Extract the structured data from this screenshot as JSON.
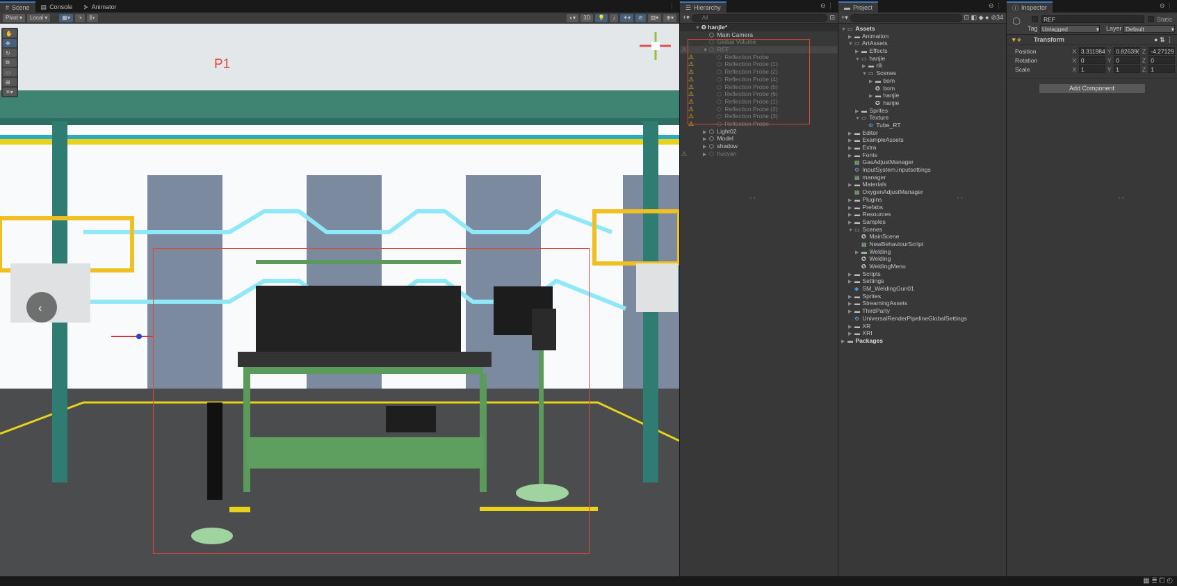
{
  "scene_panel": {
    "tabs": [
      "Scene",
      "Console",
      "Animator"
    ],
    "toolbar": {
      "pivot": "Pivot",
      "local": "Local",
      "mode_2d": "3D"
    },
    "annotation": "P1"
  },
  "hierarchy": {
    "title": "Hierarchy",
    "search_placeholder": "All",
    "scene_name": "hanjie*",
    "items": [
      {
        "label": "Main Camera",
        "depth": 1,
        "dim": false
      },
      {
        "label": "Global Volume",
        "depth": 1,
        "dim": true
      },
      {
        "label": "REF",
        "depth": 1,
        "dim": true,
        "expanded": true,
        "warn": true,
        "selected": true
      },
      {
        "label": "Reflection Probe",
        "depth": 2,
        "dim": true,
        "warn": true
      },
      {
        "label": "Reflection Probe (1)",
        "depth": 2,
        "dim": true,
        "warn": true
      },
      {
        "label": "Reflection Probe (2)",
        "depth": 2,
        "dim": true,
        "warn": true
      },
      {
        "label": "Reflection Probe (4)",
        "depth": 2,
        "dim": true,
        "warn": true
      },
      {
        "label": "Reflection Probe (5)",
        "depth": 2,
        "dim": true,
        "warn": true
      },
      {
        "label": "Reflection Probe (6)",
        "depth": 2,
        "dim": true,
        "warn": true
      },
      {
        "label": "Reflection Probe (1)",
        "depth": 2,
        "dim": true,
        "warn": true
      },
      {
        "label": "Reflection Probe (2)",
        "depth": 2,
        "dim": true,
        "warn": true
      },
      {
        "label": "Reflection Probe (3)",
        "depth": 2,
        "dim": true,
        "warn": true
      },
      {
        "label": "Reflection Probe",
        "depth": 2,
        "dim": true,
        "warn": true
      },
      {
        "label": "Light02",
        "depth": 1,
        "dim": false,
        "collapsed": true
      },
      {
        "label": "Model",
        "depth": 1,
        "dim": false,
        "collapsed": true
      },
      {
        "label": "shadow",
        "depth": 1,
        "dim": false,
        "collapsed": true
      },
      {
        "label": "huoyan",
        "depth": 1,
        "dim": true,
        "collapsed": true,
        "warn": true
      }
    ]
  },
  "project": {
    "title": "Project",
    "hidden_count": "34",
    "items": [
      {
        "label": "Assets",
        "d": 0,
        "t": "fo",
        "bold": true
      },
      {
        "label": "Animation",
        "d": 1,
        "t": "f"
      },
      {
        "label": "ArtAssets",
        "d": 1,
        "t": "fo"
      },
      {
        "label": "Effects",
        "d": 2,
        "t": "f"
      },
      {
        "label": "hanjie",
        "d": 2,
        "t": "fo"
      },
      {
        "label": "rili",
        "d": 3,
        "t": "f"
      },
      {
        "label": "Scenes",
        "d": 3,
        "t": "fo"
      },
      {
        "label": "bom",
        "d": 4,
        "t": "f"
      },
      {
        "label": "bom",
        "d": 4,
        "t": "s"
      },
      {
        "label": "hanjie",
        "d": 4,
        "t": "f"
      },
      {
        "label": "hanjie",
        "d": 4,
        "t": "s"
      },
      {
        "label": "Sprites",
        "d": 2,
        "t": "f"
      },
      {
        "label": "Texture",
        "d": 2,
        "t": "fo"
      },
      {
        "label": "Tube_RT",
        "d": 3,
        "t": "x"
      },
      {
        "label": "Editor",
        "d": 1,
        "t": "f"
      },
      {
        "label": "ExampleAssets",
        "d": 1,
        "t": "f"
      },
      {
        "label": "Extra",
        "d": 1,
        "t": "f"
      },
      {
        "label": "Fonts",
        "d": 1,
        "t": "f"
      },
      {
        "label": "GasAdjustManager",
        "d": 1,
        "t": "c"
      },
      {
        "label": "InputSystem.inputsettings",
        "d": 1,
        "t": "x"
      },
      {
        "label": "manager",
        "d": 1,
        "t": "c"
      },
      {
        "label": "Materials",
        "d": 1,
        "t": "f"
      },
      {
        "label": "OxygenAdjustManager",
        "d": 1,
        "t": "c"
      },
      {
        "label": "Plugins",
        "d": 1,
        "t": "f"
      },
      {
        "label": "Prefabs",
        "d": 1,
        "t": "f"
      },
      {
        "label": "Resources",
        "d": 1,
        "t": "f"
      },
      {
        "label": "Samples",
        "d": 1,
        "t": "f"
      },
      {
        "label": "Scenes",
        "d": 1,
        "t": "fo"
      },
      {
        "label": "MainScene",
        "d": 2,
        "t": "s"
      },
      {
        "label": "NewBehaviourScript",
        "d": 2,
        "t": "c"
      },
      {
        "label": "Welding",
        "d": 2,
        "t": "f"
      },
      {
        "label": "Welding",
        "d": 2,
        "t": "s"
      },
      {
        "label": "WeldingMenu",
        "d": 2,
        "t": "s"
      },
      {
        "label": "Scripts",
        "d": 1,
        "t": "f"
      },
      {
        "label": "Settings",
        "d": 1,
        "t": "f"
      },
      {
        "label": "SM_WeldingGun01",
        "d": 1,
        "t": "m"
      },
      {
        "label": "Sprites",
        "d": 1,
        "t": "f"
      },
      {
        "label": "StreamingAssets",
        "d": 1,
        "t": "f"
      },
      {
        "label": "ThirdParty",
        "d": 1,
        "t": "f"
      },
      {
        "label": "UniversalRenderPipelineGlobalSettings",
        "d": 1,
        "t": "x"
      },
      {
        "label": "XR",
        "d": 1,
        "t": "f"
      },
      {
        "label": "XRI",
        "d": 1,
        "t": "f"
      },
      {
        "label": "Packages",
        "d": 0,
        "t": "f",
        "bold": true
      }
    ]
  },
  "inspector": {
    "title": "Inspector",
    "object_name": "REF",
    "static_label": "Static",
    "tag_label": "Tag",
    "tag_value": "Untagged",
    "layer_label": "Layer",
    "layer_value": "Default",
    "component": "Transform",
    "rows": [
      {
        "label": "Position",
        "x": "3.311984",
        "y": "0.826396",
        "z": "-4.27129"
      },
      {
        "label": "Rotation",
        "x": "0",
        "y": "0",
        "z": "0"
      },
      {
        "label": "Scale",
        "x": "1",
        "y": "1",
        "z": "1"
      }
    ],
    "axis": {
      "x": "X",
      "y": "Y",
      "z": "Z"
    },
    "add_component": "Add Component"
  },
  "colors": {
    "accent": "#3a79bb",
    "annotation": "#e0483a",
    "warning": "#f0c020"
  }
}
